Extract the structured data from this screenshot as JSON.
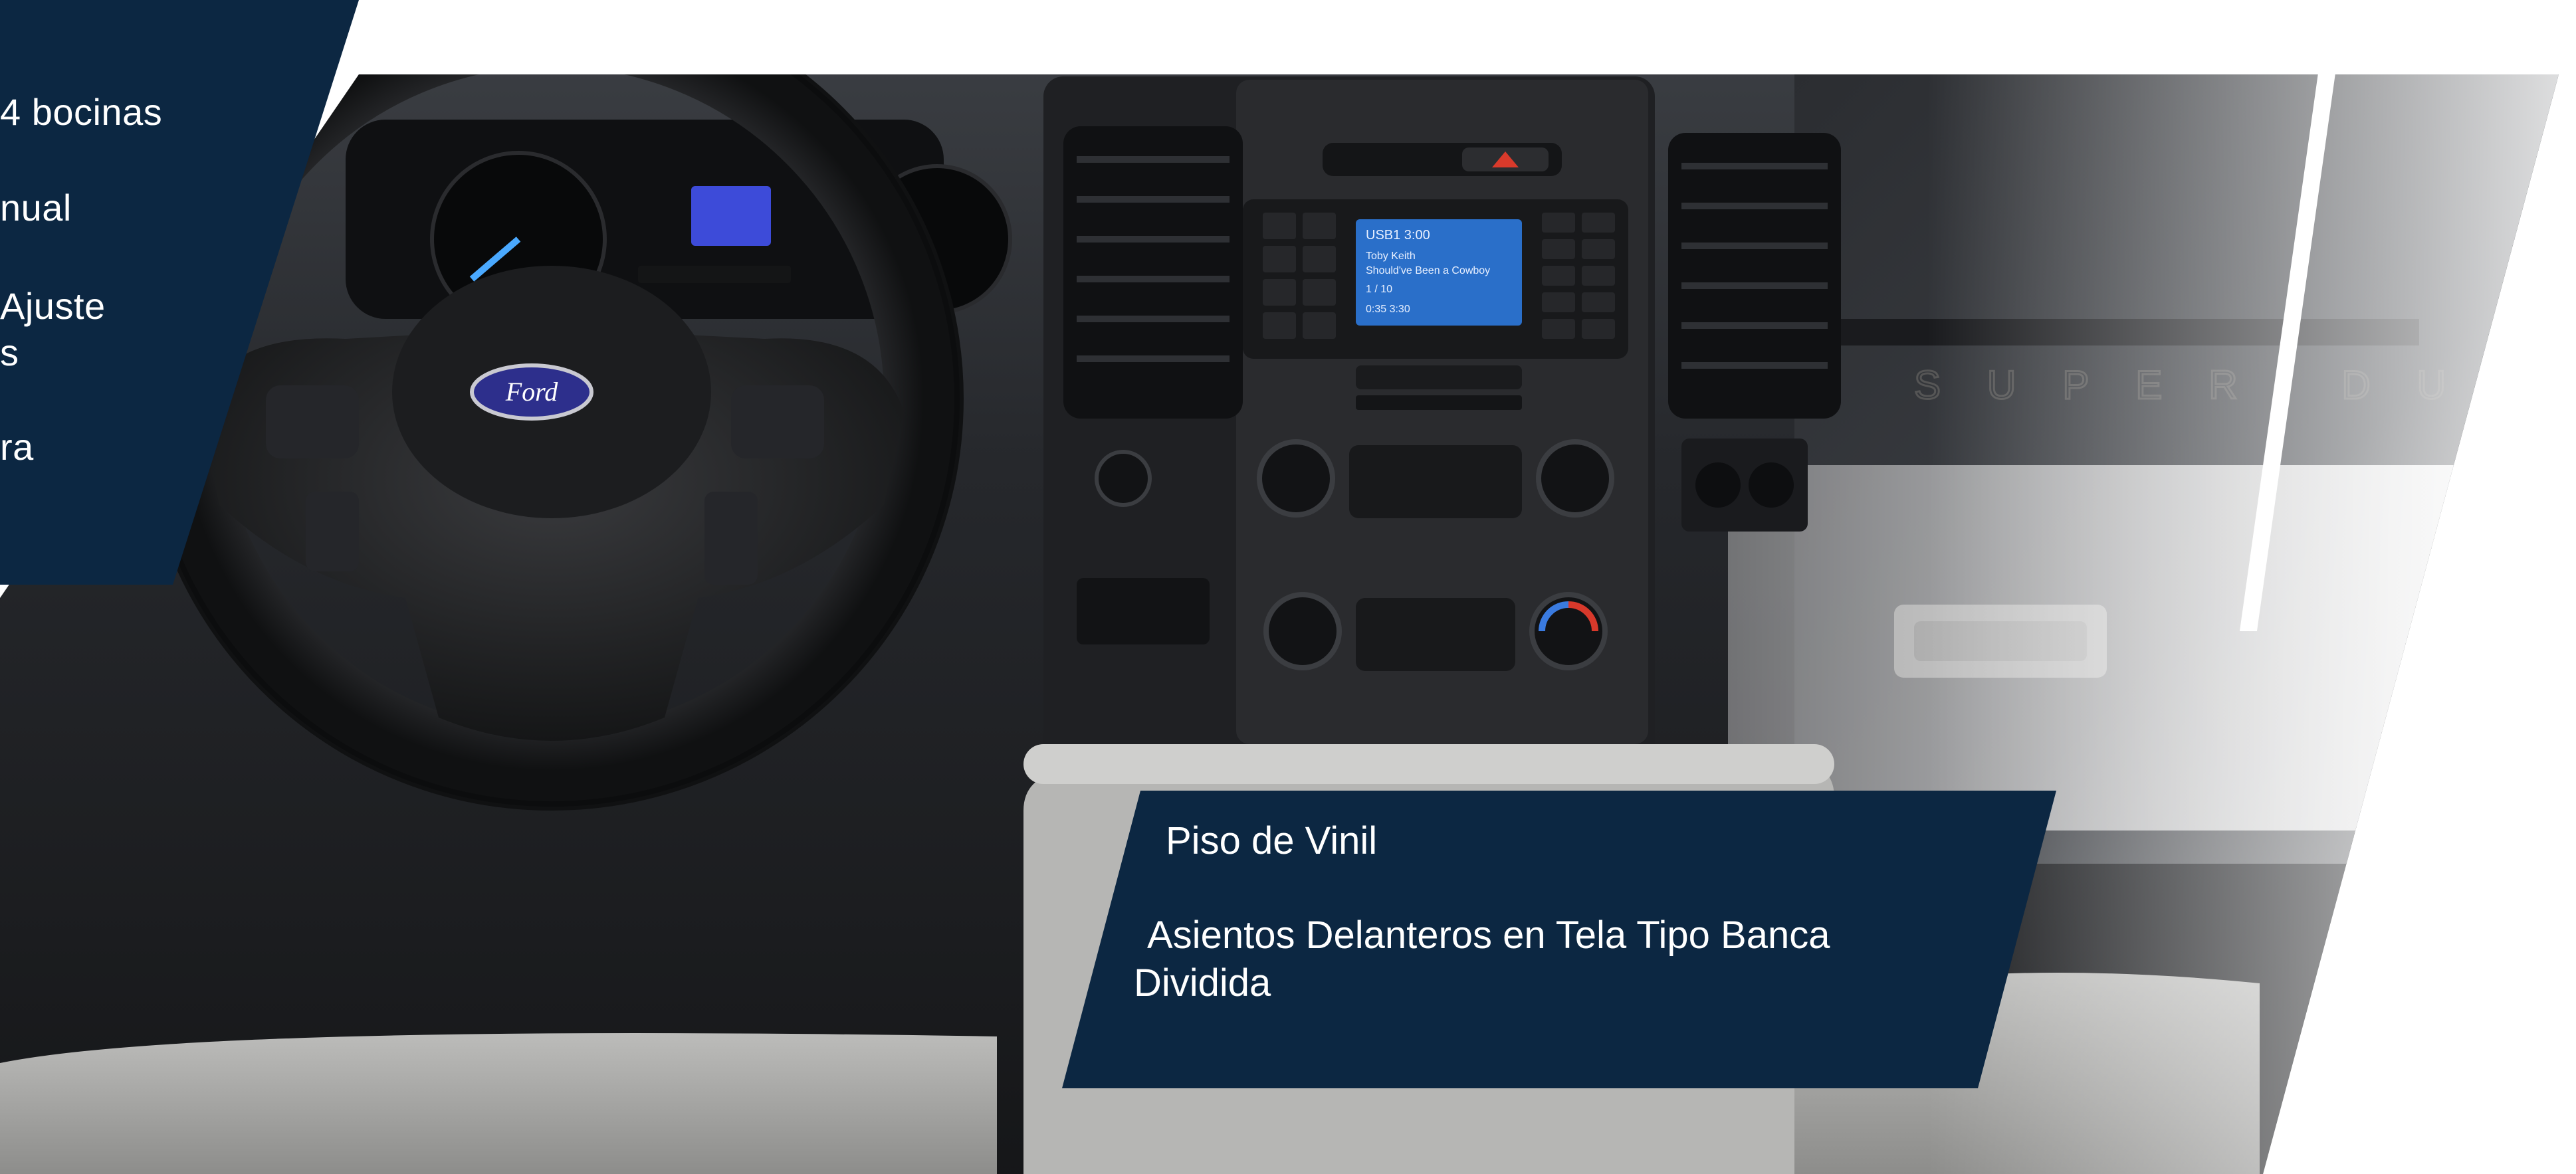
{
  "left_panel": {
    "features": [
      "4 bocinas",
      "nual",
      "Ajuste",
      "s",
      "ra"
    ]
  },
  "info_panel": {
    "line1": "Piso de Vinil",
    "line2": "Asientos Delanteros en Tela Tipo Banca",
    "line3": "Dividida"
  },
  "photo": {
    "steering_wheel_logo": "Ford",
    "radio_screen": {
      "source": "USB1",
      "time": "3:00",
      "artist": "Toby Keith",
      "track": "Should've Been a Cowboy",
      "track_index": "1 / 10",
      "elapsed": "0:35",
      "total": "3:30"
    },
    "dash_badge": "SUPER DUTY"
  },
  "colors": {
    "navy": "#0c2742",
    "white": "#ffffff",
    "dash_dark": "#1b1c1f",
    "seat_gray": "#a8a8a6",
    "screen_blue": "#2a6fc9"
  }
}
